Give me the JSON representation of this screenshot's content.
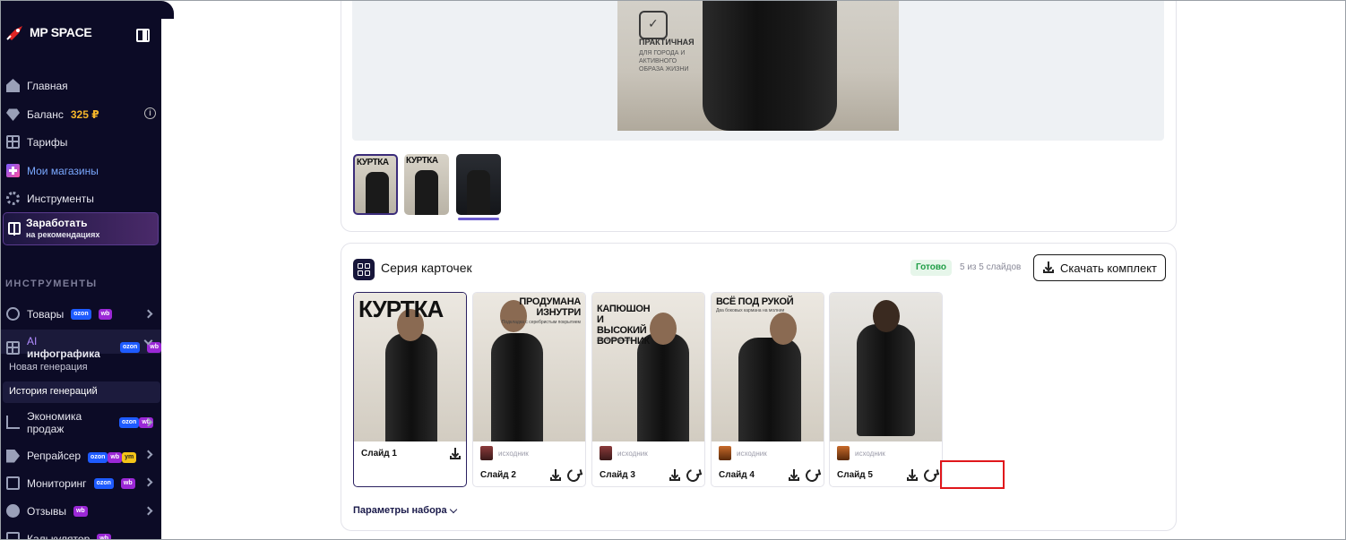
{
  "brand": {
    "name": "MP SPACE"
  },
  "sidebar": {
    "items": [
      {
        "label": "Главная"
      },
      {
        "label": "Баланс",
        "value": "325 ₽"
      },
      {
        "label": "Тарифы"
      },
      {
        "label": "Мои магазины"
      },
      {
        "label": "Инструменты"
      }
    ],
    "earn": {
      "title": "Заработать",
      "subtitle": "на рекомендациях"
    },
    "section_title": "ИНСТРУМЕНТЫ",
    "tools": [
      {
        "label": "Товары",
        "badges": [
          "ozon",
          "wb"
        ]
      },
      {
        "label_prefix": "AI",
        "label": "инфографика",
        "badges": [
          "ozon",
          "wb"
        ]
      },
      {
        "label": "Экономика продаж",
        "badges": [
          "ozon",
          "wb"
        ]
      },
      {
        "label": "Репрайсер",
        "badges": [
          "ozon",
          "wb",
          "ym"
        ]
      },
      {
        "label": "Мониторинг",
        "badges": [
          "ozon",
          "wb"
        ]
      },
      {
        "label": "Отзывы",
        "badges": [
          "wb"
        ]
      },
      {
        "label": "Калькулятор",
        "badges": [
          "wb"
        ]
      }
    ],
    "sub_items": [
      {
        "label": "Новая генерация"
      },
      {
        "label": "История генераций"
      }
    ]
  },
  "preview": {
    "title": "ПРАКТИЧНАЯ",
    "text": "ДЛЯ ГОРОДА И АКТИВНОГО ОБРАЗА ЖИЗНИ"
  },
  "thumbnails": [
    {
      "label": "КУРТКА"
    },
    {
      "label": "КУРТКА"
    },
    {
      "label": ""
    }
  ],
  "series": {
    "title": "Серия карточек",
    "status": "Готово",
    "count": "5 из 5 слайдов",
    "download_all": "Скачать комплект",
    "params": "Параметры набора",
    "source_label": "исходник",
    "slides": [
      {
        "label": "Слайд 1",
        "headline": "КУРТКА",
        "sub": ""
      },
      {
        "label": "Слайд 2",
        "headline": "ПРОДУМАНА ИЗНУТРИ",
        "sub": "Подкладка с серебристым покрытием"
      },
      {
        "label": "Слайд 3",
        "headline": "КАПЮШОН И ВЫСОКИЙ ВОРОТНИК",
        "sub": "Застёжка до шеи"
      },
      {
        "label": "Слайд 4",
        "headline": "ВСЁ ПОД РУКОЙ",
        "sub": "Два боковых кармана на молнии"
      },
      {
        "label": "Слайд 5",
        "headline": "",
        "sub": ""
      }
    ]
  },
  "colors": {
    "sidebar_bg": "#0c0b26",
    "accent": "#3b2c7a",
    "ready": "#1f9d46",
    "highlight": "#e0161b"
  }
}
